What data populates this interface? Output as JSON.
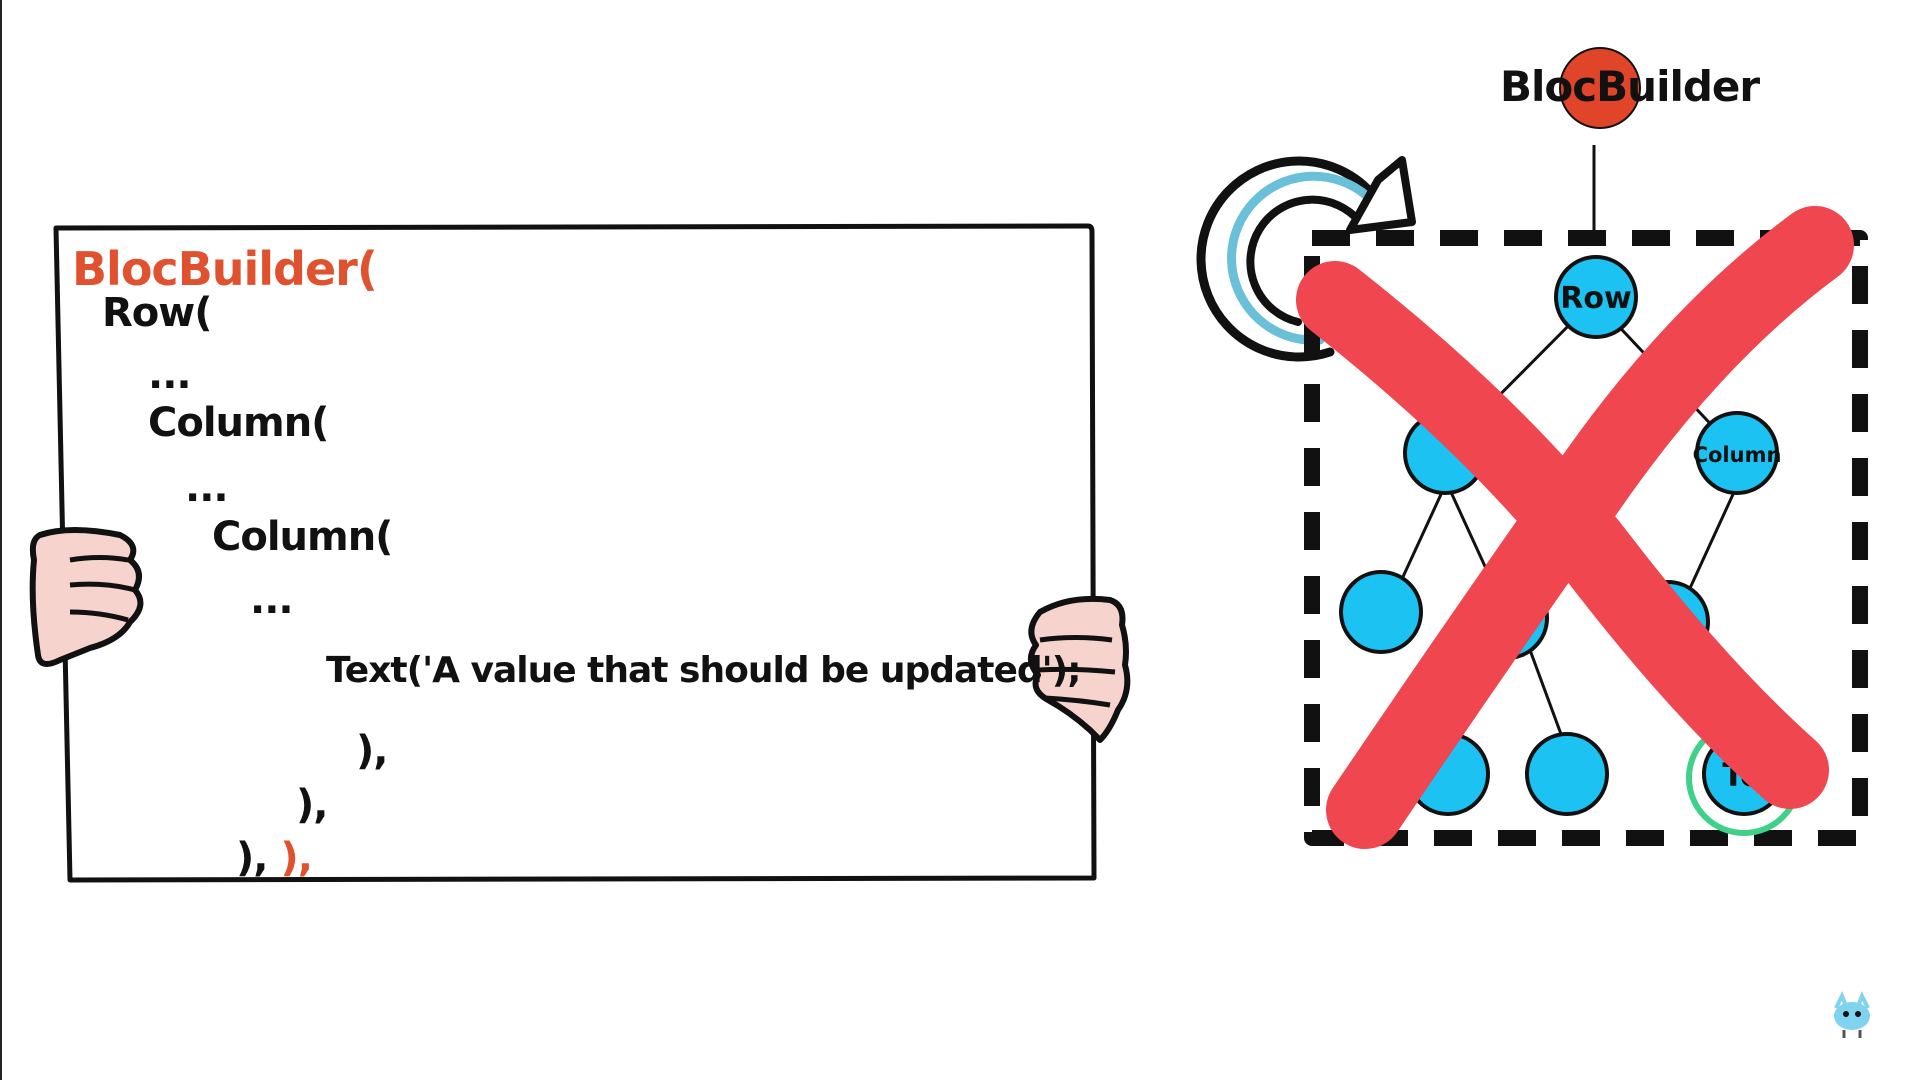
{
  "code_board": {
    "lines": [
      {
        "text": "BlocBuilder(",
        "accent": true
      },
      {
        "text": "Row("
      },
      {
        "text": "..."
      },
      {
        "text": "Column("
      },
      {
        "text": "..."
      },
      {
        "text": "Column("
      },
      {
        "text": "..."
      },
      {
        "text": "Text('A value that should be updated');"
      },
      {
        "text": "),"
      },
      {
        "text": "),"
      },
      {
        "text": "),",
        "accent_suffix": " ),"
      }
    ]
  },
  "tree_diagram": {
    "title": "BlocBuilder",
    "nodes": {
      "root": "Row",
      "right": "Column",
      "leaf": "Te"
    }
  },
  "colors": {
    "accent": "#e0522f",
    "node_fill": "#1cc2f2",
    "cross": "#ef4650",
    "arrow": "#6ac0d8",
    "highlight": "#3fd18a",
    "hand": "#f6d3cc"
  },
  "icons": [
    "hand-icon",
    "refresh-arrow-icon",
    "cross-icon",
    "mascot-icon"
  ]
}
